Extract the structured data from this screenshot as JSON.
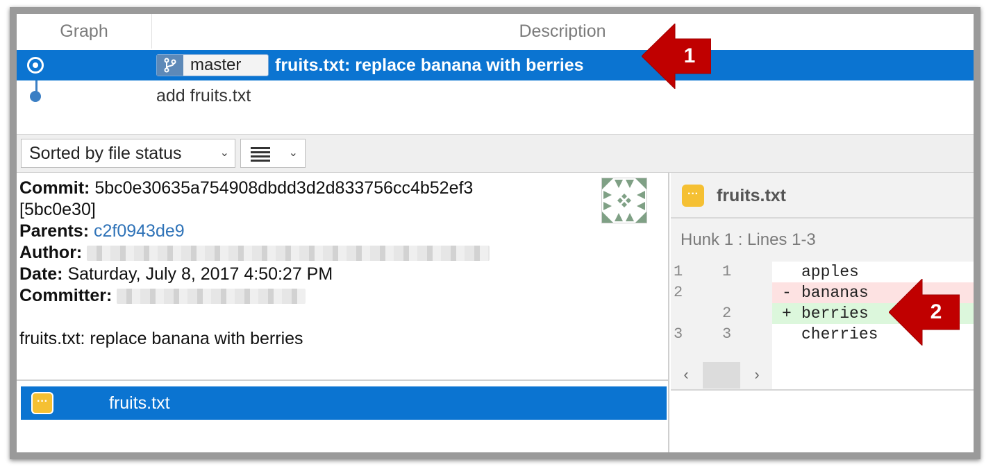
{
  "columns": {
    "graph": "Graph",
    "description": "Description"
  },
  "commits": [
    {
      "branch": "master",
      "message": "fruits.txt: replace banana with berries",
      "selected": true
    },
    {
      "message": "add fruits.txt",
      "selected": false
    }
  ],
  "toolbar": {
    "sort_label": "Sorted by file status",
    "view_icon": "list-icon"
  },
  "details": {
    "commit_label": "Commit:",
    "commit_hash": "5bc0e30635a754908dbdd3d2d833756cc4b52ef3",
    "commit_short": "[5bc0e30]",
    "parents_label": "Parents:",
    "parents_value": "c2f0943de9",
    "author_label": "Author:",
    "date_label": "Date:",
    "date_value": "Saturday, July 8, 2017 4:50:27 PM",
    "committer_label": "Committer:",
    "message": "fruits.txt: replace banana with berries"
  },
  "files": [
    {
      "name": "fruits.txt",
      "status_icon": "modified-icon"
    }
  ],
  "diff": {
    "file_name": "fruits.txt",
    "hunk_label": "Hunk 1 : Lines 1-3",
    "lines": [
      {
        "old": "1",
        "new": "1",
        "prefix": " ",
        "text": "apples",
        "type": "context"
      },
      {
        "old": "2",
        "new": "",
        "prefix": "-",
        "text": "bananas",
        "type": "del"
      },
      {
        "old": "",
        "new": "2",
        "prefix": "+",
        "text": "berries",
        "type": "add"
      },
      {
        "old": "3",
        "new": "3",
        "prefix": " ",
        "text": "cherries",
        "type": "context"
      }
    ],
    "scroll_left": "‹",
    "scroll_right": "›"
  },
  "annotations": [
    "1",
    "2"
  ],
  "colors": {
    "selection": "#0b74d1",
    "callout": "#c00000",
    "deleted": "#fde2e2",
    "added": "#dcf7dc"
  }
}
